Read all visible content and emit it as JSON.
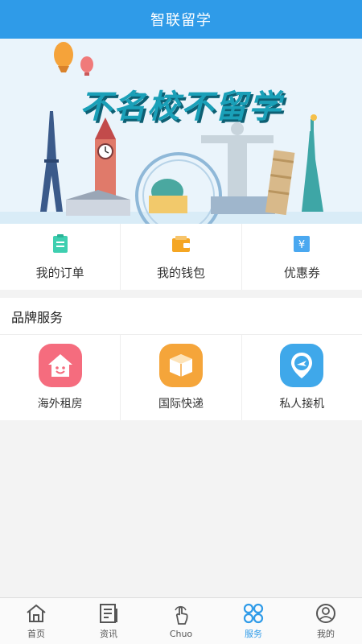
{
  "header": {
    "title": "智联留学"
  },
  "banner": {
    "slogan": "不名校不留学"
  },
  "quick": [
    {
      "name": "my-orders",
      "label": "我的订单",
      "icon": "clipboard-icon",
      "color": "#3ecfb0"
    },
    {
      "name": "my-wallet",
      "label": "我的钱包",
      "icon": "wallet-icon",
      "color": "#f5a623"
    },
    {
      "name": "coupons",
      "label": "优惠券",
      "icon": "yen-coupon-icon",
      "color": "#4aa8f0"
    }
  ],
  "brand": {
    "title": "品牌服务",
    "items": [
      {
        "name": "overseas-rental",
        "label": "海外租房",
        "icon": "house-smile-icon",
        "color": "#f56c7e"
      },
      {
        "name": "intl-express",
        "label": "国际快递",
        "icon": "package-box-icon",
        "color": "#f5a53a"
      },
      {
        "name": "private-pickup",
        "label": "私人接机",
        "icon": "plane-pin-icon",
        "color": "#3fa8ea"
      }
    ]
  },
  "tabs": [
    {
      "name": "home",
      "label": "首页",
      "icon": "home-icon",
      "active": false
    },
    {
      "name": "news",
      "label": "资讯",
      "icon": "news-icon",
      "active": false
    },
    {
      "name": "chuo",
      "label": "Chuo",
      "icon": "tap-hand-icon",
      "active": false
    },
    {
      "name": "services",
      "label": "服务",
      "icon": "clover-grid-icon",
      "active": true
    },
    {
      "name": "mine",
      "label": "我的",
      "icon": "profile-icon",
      "active": false
    }
  ],
  "colors": {
    "primary": "#2f9be8",
    "slogan": "#1aa0b8"
  }
}
